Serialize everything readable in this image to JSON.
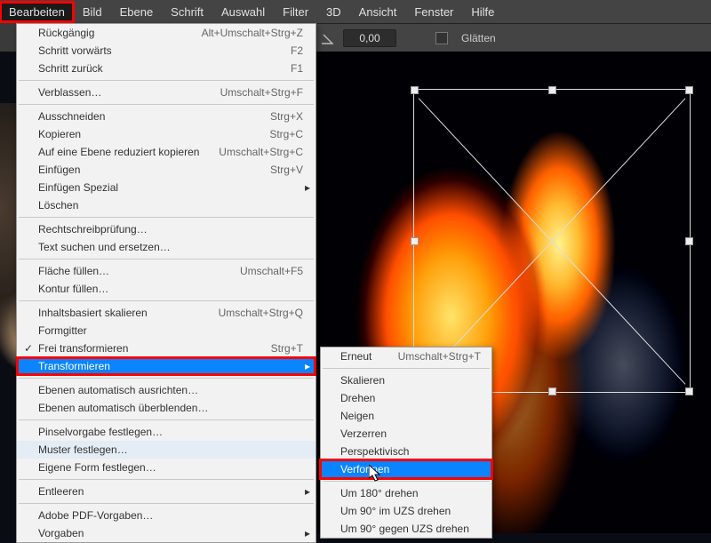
{
  "menubar": {
    "items": [
      "Bearbeiten",
      "Bild",
      "Ebene",
      "Schrift",
      "Auswahl",
      "Filter",
      "3D",
      "Ansicht",
      "Fenster",
      "Hilfe"
    ],
    "active_index": 0
  },
  "options_bar": {
    "angle_value": "0,00",
    "smooth_label": "Glätten"
  },
  "edit_menu": {
    "groups": [
      [
        {
          "label": "Rückgängig",
          "shortcut": "Alt+Umschalt+Strg+Z"
        },
        {
          "label": "Schritt vorwärts",
          "shortcut": "F2"
        },
        {
          "label": "Schritt zurück",
          "shortcut": "F1"
        }
      ],
      [
        {
          "label": "Verblassen…",
          "shortcut": "Umschalt+Strg+F"
        }
      ],
      [
        {
          "label": "Ausschneiden",
          "shortcut": "Strg+X"
        },
        {
          "label": "Kopieren",
          "shortcut": "Strg+C"
        },
        {
          "label": "Auf eine Ebene reduziert kopieren",
          "shortcut": "Umschalt+Strg+C"
        },
        {
          "label": "Einfügen",
          "shortcut": "Strg+V"
        },
        {
          "label": "Einfügen Spezial",
          "shortcut": "",
          "submenu": true
        },
        {
          "label": "Löschen",
          "shortcut": ""
        }
      ],
      [
        {
          "label": "Rechtschreibprüfung…",
          "shortcut": ""
        },
        {
          "label": "Text suchen und ersetzen…",
          "shortcut": ""
        }
      ],
      [
        {
          "label": "Fläche füllen…",
          "shortcut": "Umschalt+F5"
        },
        {
          "label": "Kontur füllen…",
          "shortcut": ""
        }
      ],
      [
        {
          "label": "Inhaltsbasiert skalieren",
          "shortcut": "Umschalt+Strg+Q"
        },
        {
          "label": "Formgitter",
          "shortcut": ""
        },
        {
          "label": "Frei transformieren",
          "shortcut": "Strg+T",
          "check": true
        },
        {
          "label": "Transformieren",
          "shortcut": "",
          "submenu": true,
          "highlight": true
        }
      ],
      [
        {
          "label": "Ebenen automatisch ausrichten…",
          "shortcut": ""
        },
        {
          "label": "Ebenen automatisch überblenden…",
          "shortcut": ""
        }
      ],
      [
        {
          "label": "Pinselvorgabe festlegen…",
          "shortcut": ""
        },
        {
          "label": "Muster festlegen…",
          "shortcut": "",
          "hover": true
        },
        {
          "label": "Eigene Form festlegen…",
          "shortcut": ""
        }
      ],
      [
        {
          "label": "Entleeren",
          "shortcut": "",
          "submenu": true
        }
      ],
      [
        {
          "label": "Adobe PDF-Vorgaben…",
          "shortcut": ""
        },
        {
          "label": "Vorgaben",
          "shortcut": "",
          "submenu": true
        }
      ]
    ]
  },
  "transform_submenu": {
    "groups": [
      [
        {
          "label": "Erneut",
          "shortcut": "Umschalt+Strg+T"
        }
      ],
      [
        {
          "label": "Skalieren"
        },
        {
          "label": "Drehen"
        },
        {
          "label": "Neigen"
        },
        {
          "label": "Verzerren"
        },
        {
          "label": "Perspektivisch"
        },
        {
          "label": "Verformen",
          "highlight": true
        }
      ],
      [
        {
          "label": "Um 180° drehen"
        },
        {
          "label": "Um 90° im UZS drehen"
        },
        {
          "label": "Um 90° gegen UZS drehen"
        }
      ]
    ]
  }
}
